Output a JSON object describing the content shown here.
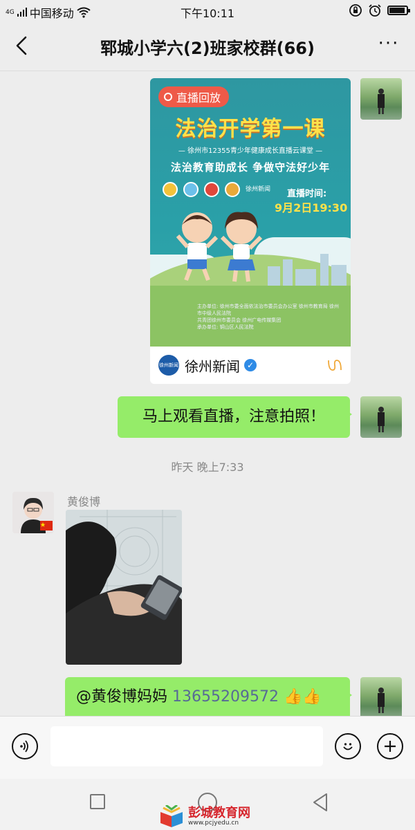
{
  "status_bar": {
    "signal_label": "4G",
    "carrier": "中国移动",
    "time": "下午10:11",
    "icons": [
      "signal-icon",
      "wifi-icon",
      "lock-rotation-icon",
      "alarm-icon",
      "battery-icon"
    ],
    "battery_level": 0.9
  },
  "header": {
    "title": "郓城小学六(2)班家校群(66)",
    "back_icon": "chevron-left-icon",
    "more_icon": "more-dots-icon",
    "more_label": "···"
  },
  "messages": {
    "card": {
      "badge": "直播回放",
      "poster_title": "法治开学第一课",
      "poster_subtitle": "— 徐州市12355青少年健康成长直播云课堂 —",
      "poster_slogan": "法治教育助成长  争做守法好少年",
      "airtime_label": "直播时间:",
      "airtime": "9月2日19:30",
      "small_logo_text": "徐州新闻",
      "footer_lines": [
        "主办单位: 徐州市委全面依法治市委员会办公室  徐州市教育局  徐州市中级人民法院",
        "共青团徐州市委员会  徐州广电传媒集团",
        "承办单位: 铜山区人民法院"
      ],
      "source_name": "徐州新闻",
      "source_logo_text": "徐州新闻",
      "verified_icon": "verified-check-icon",
      "miniprogram_icon": "mini-program-icon"
    },
    "outgoing_text": "马上观看直播，注意拍照！",
    "timestamp": "昨天 晚上7:33",
    "incoming": {
      "sender": "黄俊博",
      "flag_icon": "china-flag-icon"
    },
    "last_outgoing": {
      "mention": "@黄俊博妈妈 ",
      "phone": "13655209572",
      "emoji": "👍👍"
    }
  },
  "input_bar": {
    "voice_icon": "voice-icon",
    "emoji_icon": "emoji-icon",
    "plus_icon": "plus-icon",
    "placeholder": ""
  },
  "nav_bar": {
    "icons": [
      "recent-apps-icon",
      "home-icon",
      "back-triangle-icon"
    ]
  },
  "watermark": {
    "name": "彭城教育网",
    "url": "www.pcjyedu.cn"
  }
}
